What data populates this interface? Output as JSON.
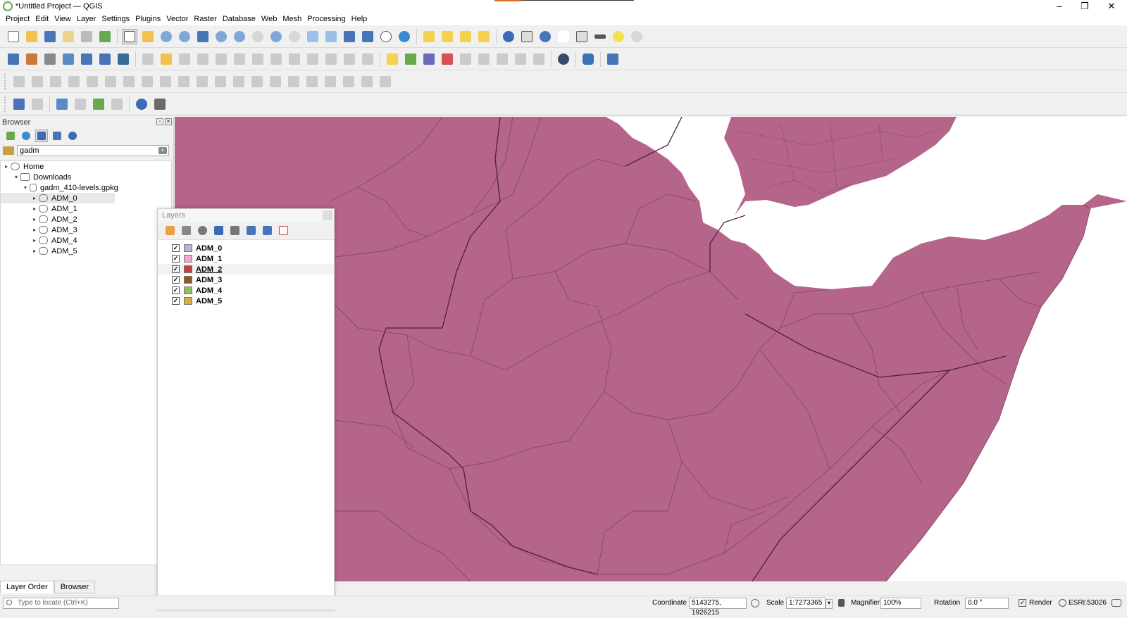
{
  "window": {
    "title": "*Untitled Project — QGIS"
  },
  "menu": [
    "Project",
    "Edit",
    "View",
    "Layer",
    "Settings",
    "Plugins",
    "Vector",
    "Raster",
    "Database",
    "Web",
    "Mesh",
    "Processing",
    "Help"
  ],
  "browser": {
    "title": "Browser",
    "filter_value": "gadm",
    "tree": [
      {
        "label": "Home",
        "level": 0,
        "arrow": "▸"
      },
      {
        "label": "Downloads",
        "level": 1,
        "arrow": "▾"
      },
      {
        "label": "gadm_410-levels.gpkg",
        "level": 2,
        "arrow": "▾"
      },
      {
        "label": "ADM_0",
        "level": 3,
        "arrow": "▸"
      },
      {
        "label": "ADM_1",
        "level": 3,
        "arrow": "▸"
      },
      {
        "label": "ADM_2",
        "level": 3,
        "arrow": "▸"
      },
      {
        "label": "ADM_3",
        "level": 3,
        "arrow": "▸"
      },
      {
        "label": "ADM_4",
        "level": 3,
        "arrow": "▸"
      },
      {
        "label": "ADM_5",
        "level": 3,
        "arrow": "▸"
      }
    ],
    "tabs": [
      "Layer Order",
      "Browser"
    ]
  },
  "layers": {
    "title": "Layers",
    "items": [
      {
        "label": "ADM_0",
        "color": "#c3b0d6"
      },
      {
        "label": "ADM_1",
        "color": "#f2a8c4"
      },
      {
        "label": "ADM_2",
        "color": "#c43c3c"
      },
      {
        "label": "ADM_3",
        "color": "#8c5a28"
      },
      {
        "label": "ADM_4",
        "color": "#8cc05c"
      },
      {
        "label": "ADM_5",
        "color": "#d8b040"
      }
    ]
  },
  "status": {
    "locate_placeholder": "Type to locate (Ctrl+K)",
    "coordinate_label": "Coordinate",
    "coordinate_value": "5143275, 1926215",
    "scale_label": "Scale",
    "scale_value": "1:7273365",
    "magnifier_label": "Magnifier",
    "magnifier_value": "100%",
    "rotation_label": "Rotation",
    "rotation_value": "0.0 °",
    "render_label": "Render",
    "crs": "ESRI:53026"
  },
  "colors": {
    "map_fill": "#b5648a",
    "boundary": "#6e3556"
  }
}
